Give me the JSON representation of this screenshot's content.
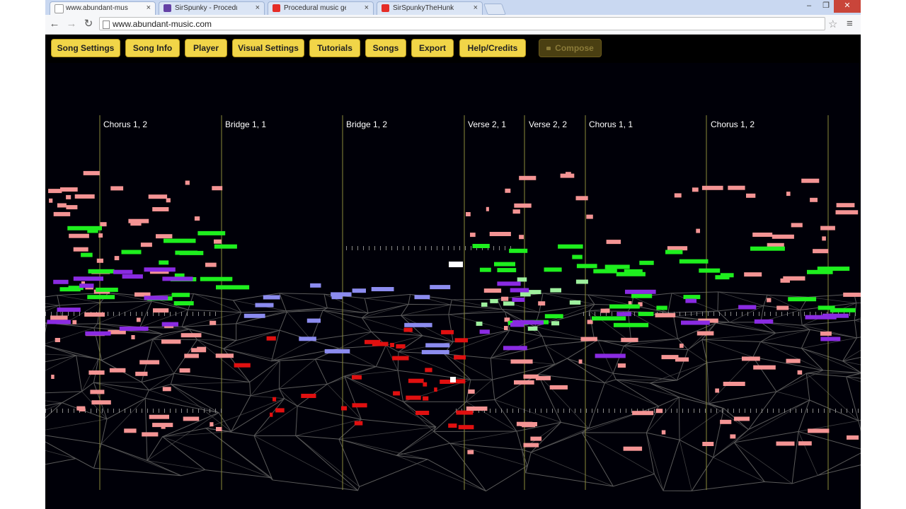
{
  "browser": {
    "tabs": [
      {
        "title": "www.abundant-music.co",
        "icon": "page-icon",
        "color": "#ffffff",
        "active": true
      },
      {
        "title": "SirSpunky - Procedural m",
        "icon": "twitch-icon",
        "color": "#6441a5",
        "active": false
      },
      {
        "title": "Procedural music generati",
        "icon": "youtube-icon",
        "color": "#e52d27",
        "active": false
      },
      {
        "title": "SirSpunkyTheHunk - YouT",
        "icon": "youtube-icon",
        "color": "#e52d27",
        "active": false
      }
    ],
    "close_glyph": "×",
    "url": "www.abundant-music.com",
    "window_controls": {
      "minimize": "–",
      "restore": "❐",
      "close": "✕"
    },
    "nav": {
      "back": "←",
      "forward": "→",
      "reload": "↻",
      "star": "☆",
      "menu": "≡"
    }
  },
  "app": {
    "buttons": [
      {
        "label": "Song Settings",
        "enabled": true
      },
      {
        "label": "Song Info",
        "enabled": true
      },
      {
        "label": "Player",
        "enabled": true
      },
      {
        "label": "Visual Settings",
        "enabled": true
      },
      {
        "label": "Tutorials",
        "enabled": true
      },
      {
        "label": "Songs",
        "enabled": true
      },
      {
        "label": "Export",
        "enabled": true
      },
      {
        "label": "Help/Credits",
        "enabled": true
      },
      {
        "label": "Compose",
        "enabled": false
      }
    ],
    "sections": [
      "Chorus 1, 2",
      "Bridge 1, 1",
      "Bridge 1, 2",
      "Verse 2, 1",
      "Verse 2, 2",
      "Chorus 1, 1",
      "Chorus 1, 2"
    ],
    "colors": {
      "background": "#000008",
      "button": "#f1d548",
      "section_line": "#8a8a3a",
      "grid": "#5a5a5a",
      "salmon": "#f49494",
      "green": "#1eef1e",
      "light_green": "#9ef09e",
      "purple": "#8a2be2",
      "periwinkle": "#8c8cef",
      "red": "#e01010",
      "white": "#ffffff"
    }
  }
}
